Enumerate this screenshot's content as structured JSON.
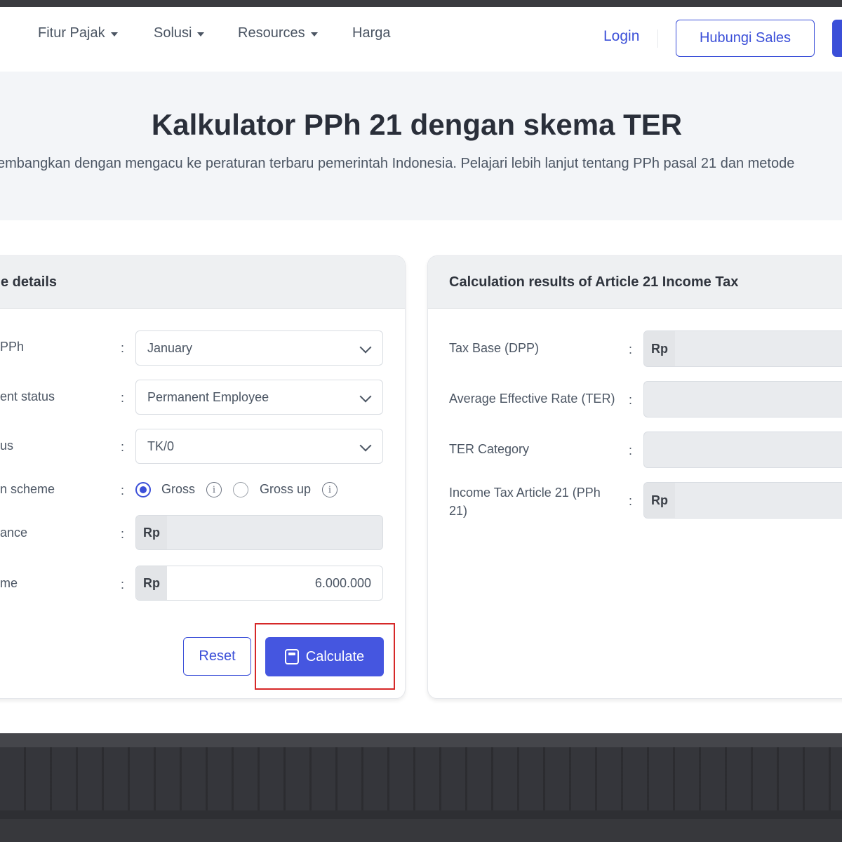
{
  "nav": {
    "items": [
      {
        "label": "Fitur Pajak",
        "dropdown": true
      },
      {
        "label": "Solusi",
        "dropdown": true
      },
      {
        "label": "Resources",
        "dropdown": true
      },
      {
        "label": "Harga",
        "dropdown": false
      }
    ],
    "login": "Login",
    "contact_sales": "Hubungi Sales"
  },
  "hero": {
    "title": "Kalkulator PPh 21 dengan skema TER",
    "subtitle": "embangkan dengan mengacu ke peraturan terbaru pemerintah Indonesia. Pelajari lebih lanjut tentang PPh pasal 21 dan metode"
  },
  "details": {
    "header": "e details",
    "rows": {
      "period": {
        "label": "PPh",
        "value": "January"
      },
      "employment": {
        "label": "ent status",
        "value": "Permanent Employee"
      },
      "status": {
        "label": "us",
        "value": "TK/0"
      },
      "scheme": {
        "label": "n scheme",
        "options": [
          "Gross",
          "Gross up"
        ],
        "selected": "Gross"
      },
      "allowance": {
        "label": "ance",
        "currency": "Rp",
        "value": ""
      },
      "income": {
        "label": "me",
        "currency": "Rp",
        "value": "6.000.000"
      }
    },
    "reset": "Reset",
    "calculate": "Calculate"
  },
  "results": {
    "header": "Calculation results of Article 21 Income Tax",
    "tax_base": {
      "label": "Tax Base (DPP)",
      "currency": "Rp"
    },
    "ter_rate": {
      "label": "Average Effective Rate (TER)"
    },
    "ter_category": {
      "label": "TER Category"
    },
    "pph21": {
      "label": "Income Tax Article 21 (PPh 21)",
      "currency": "Rp"
    }
  },
  "colors": {
    "primary": "#3b4fd8",
    "highlight": "#d62828",
    "hero_bg": "#f3f5f8"
  }
}
